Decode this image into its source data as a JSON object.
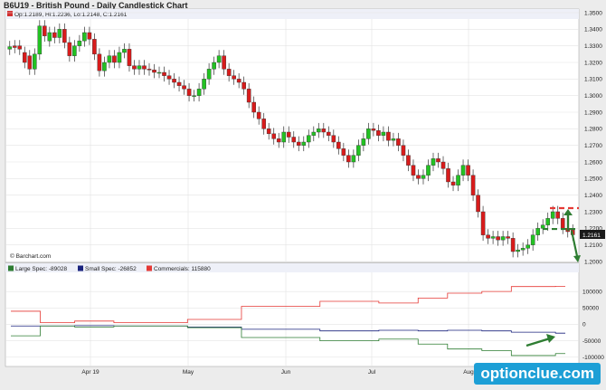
{
  "title": "B6U19 - British Pound - Daily Candlestick Chart",
  "watermark": "optionclue.com",
  "chart_data": [
    {
      "type": "candlestick",
      "ohlc_label": "Op:1.2189, Hi:1.2236, Lo:1.2148, C:1.2161",
      "source": "© Barchart.com",
      "last_value": "1.2161",
      "ylim": [
        1.2,
        1.35
      ],
      "yticks": [
        "1.3500",
        "1.3400",
        "1.3300",
        "1.3200",
        "1.3100",
        "1.3000",
        "1.2900",
        "1.2800",
        "1.2700",
        "1.2600",
        "1.2500",
        "1.2400",
        "1.2300",
        "1.2200",
        "1.2100",
        "1.2000"
      ],
      "close": [
        1.3295,
        1.329,
        1.328,
        1.32,
        1.316,
        1.325,
        1.342,
        1.336,
        1.338,
        1.335,
        1.34,
        1.332,
        1.324,
        1.33,
        1.333,
        1.338,
        1.334,
        1.325,
        1.315,
        1.32,
        1.324,
        1.32,
        1.326,
        1.328,
        1.318,
        1.316,
        1.318,
        1.316,
        1.3155,
        1.314,
        1.314,
        1.312,
        1.31,
        1.308,
        1.306,
        1.304,
        1.3,
        1.3,
        1.304,
        1.31,
        1.316,
        1.32,
        1.324,
        1.316,
        1.312,
        1.31,
        1.308,
        1.304,
        1.296,
        1.29,
        1.286,
        1.28,
        1.277,
        1.274,
        1.272,
        1.278,
        1.275,
        1.272,
        1.27,
        1.272,
        1.276,
        1.278,
        1.28,
        1.278,
        1.276,
        1.272,
        1.268,
        1.264,
        1.26,
        1.264,
        1.27,
        1.274,
        1.28,
        1.279,
        1.276,
        1.278,
        1.273,
        1.274,
        1.27,
        1.264,
        1.258,
        1.252,
        1.25,
        1.252,
        1.258,
        1.262,
        1.26,
        1.256,
        1.248,
        1.246,
        1.252,
        1.258,
        1.252,
        1.24,
        1.23,
        1.216,
        1.214,
        1.215,
        1.213,
        1.215,
        1.214,
        1.206,
        1.207,
        1.208,
        1.21,
        1.216,
        1.22,
        1.222,
        1.226,
        1.23,
        1.226,
        1.22,
        1.218,
        1.2161
      ],
      "open": [
        1.328,
        1.33,
        1.33,
        1.326,
        1.324,
        1.316,
        1.325,
        1.342,
        1.333,
        1.338,
        1.335,
        1.34,
        1.332,
        1.324,
        1.33,
        1.333,
        1.338,
        1.334,
        1.325,
        1.315,
        1.32,
        1.324,
        1.32,
        1.326,
        1.328,
        1.318,
        1.316,
        1.318,
        1.316,
        1.3155,
        1.314,
        1.314,
        1.312,
        1.31,
        1.308,
        1.306,
        1.304,
        1.3,
        1.3,
        1.304,
        1.31,
        1.316,
        1.32,
        1.324,
        1.316,
        1.312,
        1.31,
        1.308,
        1.304,
        1.296,
        1.29,
        1.286,
        1.28,
        1.277,
        1.274,
        1.272,
        1.278,
        1.275,
        1.272,
        1.27,
        1.272,
        1.276,
        1.278,
        1.28,
        1.278,
        1.276,
        1.272,
        1.268,
        1.264,
        1.26,
        1.264,
        1.27,
        1.274,
        1.28,
        1.279,
        1.276,
        1.278,
        1.273,
        1.274,
        1.27,
        1.264,
        1.258,
        1.252,
        1.25,
        1.252,
        1.258,
        1.262,
        1.26,
        1.256,
        1.248,
        1.246,
        1.252,
        1.258,
        1.252,
        1.24,
        1.23,
        1.216,
        1.214,
        1.215,
        1.213,
        1.215,
        1.214,
        1.206,
        1.207,
        1.208,
        1.21,
        1.216,
        1.22,
        1.222,
        1.226,
        1.23,
        1.226,
        1.22,
        1.2189
      ],
      "annotations": {
        "resistance_level": 1.2322,
        "support_level": 1.2196
      }
    },
    {
      "type": "line",
      "legend": [
        {
          "name": "Large Spec: -89028",
          "color": "#2e7d32"
        },
        {
          "name": "Small Spec: -26852",
          "color": "#1a237e"
        },
        {
          "name": "Commercials: 115880",
          "color": "#e53935"
        }
      ],
      "ylim": [
        -120000,
        150000
      ],
      "yticks": [
        "100000",
        "50000",
        "0",
        "-50000",
        "-100000"
      ],
      "xticks": [
        "Apr 19",
        "May",
        "Jun",
        "Jul",
        "Aug"
      ],
      "series": [
        {
          "name": "Commercials",
          "color": "#e53935",
          "values": [
            40000,
            40000,
            40000,
            40000,
            40000,
            40000,
            5000,
            5000,
            5000,
            5000,
            5000,
            5000,
            5000,
            10000,
            10000,
            10000,
            10000,
            10000,
            10000,
            10000,
            10000,
            5000,
            5000,
            5000,
            5000,
            5000,
            5000,
            5000,
            5000,
            5000,
            5000,
            5000,
            5000,
            5000,
            5000,
            5000,
            15000,
            15000,
            15000,
            15000,
            15000,
            15000,
            15000,
            15000,
            15000,
            15000,
            15000,
            55000,
            55000,
            55000,
            55000,
            55000,
            55000,
            55000,
            55000,
            55000,
            55000,
            55000,
            55000,
            55000,
            55000,
            55000,
            55000,
            70000,
            70000,
            70000,
            70000,
            70000,
            70000,
            70000,
            70000,
            70000,
            70000,
            70000,
            70000,
            65000,
            65000,
            65000,
            65000,
            65000,
            65000,
            65000,
            65000,
            80000,
            80000,
            80000,
            80000,
            80000,
            80000,
            95000,
            95000,
            95000,
            95000,
            95000,
            95000,
            95000,
            100000,
            100000,
            100000,
            100000,
            100000,
            100000,
            115000,
            115000,
            115000,
            115000,
            115000,
            115000,
            115000,
            115000,
            115000,
            115880,
            115880,
            115880
          ]
        },
        {
          "name": "Small Spec",
          "color": "#1a237e",
          "values": [
            -5000,
            -5000,
            -5000,
            -5000,
            -5000,
            -5000,
            -5000,
            -5000,
            -5000,
            -5000,
            -5000,
            -5000,
            -5000,
            -4000,
            -4000,
            -4000,
            -4000,
            -4000,
            -4000,
            -4000,
            -4000,
            -5000,
            -5000,
            -5000,
            -5000,
            -5000,
            -5000,
            -5000,
            -5000,
            -5000,
            -5000,
            -5000,
            -5000,
            -5000,
            -5000,
            -5000,
            -8000,
            -8000,
            -8000,
            -8000,
            -8000,
            -8000,
            -8000,
            -8000,
            -8000,
            -8000,
            -8000,
            -15000,
            -15000,
            -15000,
            -15000,
            -15000,
            -15000,
            -15000,
            -15000,
            -15000,
            -15000,
            -15000,
            -15000,
            -15000,
            -15000,
            -15000,
            -15000,
            -20000,
            -20000,
            -20000,
            -20000,
            -20000,
            -20000,
            -20000,
            -20000,
            -20000,
            -20000,
            -20000,
            -20000,
            -18000,
            -18000,
            -18000,
            -18000,
            -18000,
            -18000,
            -18000,
            -18000,
            -20000,
            -20000,
            -20000,
            -20000,
            -20000,
            -20000,
            -18000,
            -18000,
            -18000,
            -18000,
            -18000,
            -18000,
            -18000,
            -20000,
            -20000,
            -20000,
            -20000,
            -20000,
            -20000,
            -24000,
            -24000,
            -24000,
            -24000,
            -24000,
            -24000,
            -24000,
            -24000,
            -24000,
            -26852,
            -26852,
            -26852
          ]
        },
        {
          "name": "Large Spec",
          "color": "#2e7d32",
          "values": [
            -35000,
            -35000,
            -35000,
            -35000,
            -35000,
            -35000,
            -5000,
            -5000,
            -5000,
            -5000,
            -5000,
            -5000,
            -5000,
            -8000,
            -8000,
            -8000,
            -8000,
            -8000,
            -8000,
            -8000,
            -8000,
            -5000,
            -5000,
            -5000,
            -5000,
            -5000,
            -5000,
            -5000,
            -5000,
            -5000,
            -5000,
            -5000,
            -5000,
            -5000,
            -5000,
            -5000,
            -10000,
            -10000,
            -10000,
            -10000,
            -10000,
            -10000,
            -10000,
            -10000,
            -10000,
            -10000,
            -10000,
            -40000,
            -40000,
            -40000,
            -40000,
            -40000,
            -40000,
            -40000,
            -40000,
            -40000,
            -40000,
            -40000,
            -40000,
            -40000,
            -40000,
            -40000,
            -40000,
            -50000,
            -50000,
            -50000,
            -50000,
            -50000,
            -50000,
            -50000,
            -50000,
            -50000,
            -50000,
            -50000,
            -50000,
            -45000,
            -45000,
            -45000,
            -45000,
            -45000,
            -45000,
            -45000,
            -45000,
            -60000,
            -60000,
            -60000,
            -60000,
            -60000,
            -60000,
            -75000,
            -75000,
            -75000,
            -75000,
            -75000,
            -75000,
            -75000,
            -80000,
            -80000,
            -80000,
            -80000,
            -80000,
            -80000,
            -95000,
            -95000,
            -95000,
            -95000,
            -95000,
            -95000,
            -95000,
            -95000,
            -95000,
            -89028,
            -89028,
            -89028
          ]
        }
      ]
    }
  ]
}
